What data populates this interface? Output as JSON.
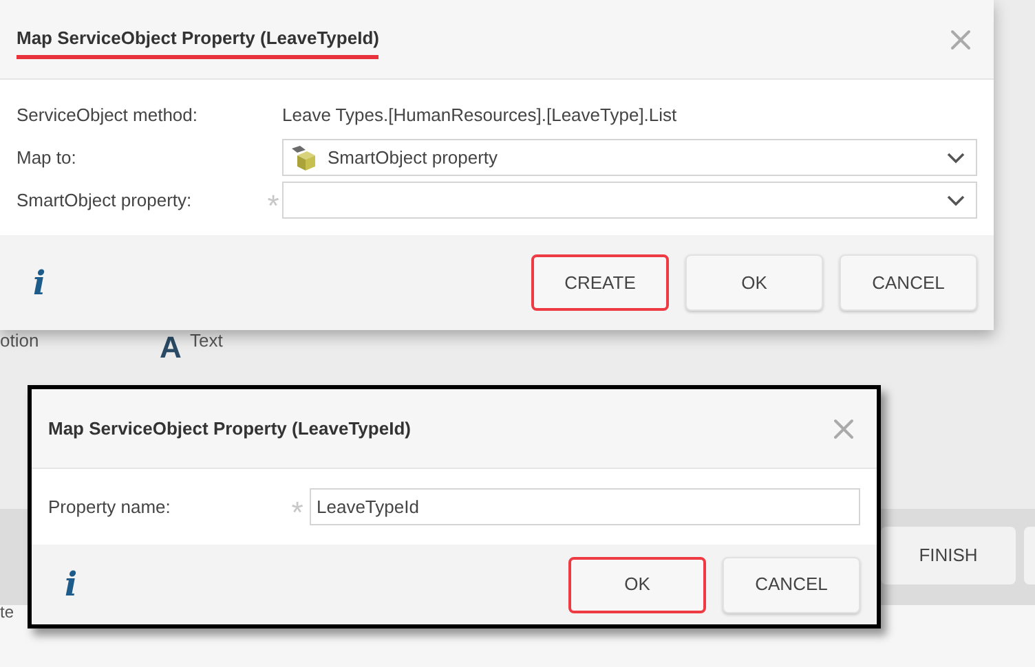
{
  "background": {
    "caption": "otion",
    "text_tool": {
      "icon": "A",
      "label": "Text"
    },
    "finish_button": "FINISH",
    "footer_caption": "te"
  },
  "dialog_main": {
    "title": "Map ServiceObject Property (LeaveTypeId)",
    "title_underlined": true,
    "rows": [
      {
        "kind": "text",
        "label": "ServiceObject method:",
        "value": "Leave Types.[HumanResources].[LeaveType].List"
      },
      {
        "kind": "select",
        "label": "Map to:",
        "value": "SmartObject property",
        "has_icon": true
      },
      {
        "kind": "select",
        "label": "SmartObject property:",
        "value": "",
        "required_mark": "*",
        "has_icon": false
      }
    ],
    "info_icon": "i",
    "buttons": [
      {
        "label": "CREATE",
        "highlighted": true
      },
      {
        "label": "OK",
        "highlighted": false
      },
      {
        "label": "CANCEL",
        "highlighted": false
      }
    ]
  },
  "dialog_property": {
    "title": "Map ServiceObject Property (LeaveTypeId)",
    "title_underlined": false,
    "rows": [
      {
        "kind": "input",
        "label": "Property name:",
        "value": "LeaveTypeId",
        "required_mark": "*"
      }
    ],
    "info_icon": "i",
    "buttons": [
      {
        "label": "OK",
        "highlighted": true
      },
      {
        "label": "CANCEL",
        "highlighted": false
      }
    ]
  }
}
